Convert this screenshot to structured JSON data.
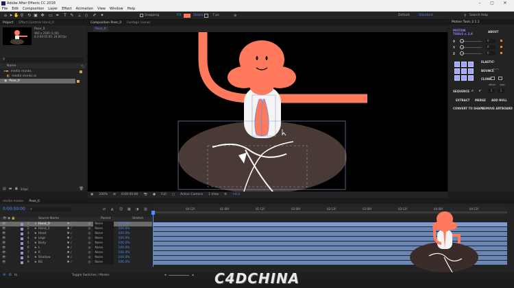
{
  "window": {
    "title": "Adobe After Effects CC 2018"
  },
  "menu": [
    "File",
    "Edit",
    "Composition",
    "Layer",
    "Effect",
    "Animation",
    "View",
    "Window",
    "Help"
  ],
  "toolbar": {
    "snapping_label": "Snapping",
    "fill_label": "Fill:",
    "stroke_label": "Stroke:",
    "stroke_px": "7 px",
    "workspace_default": "Default",
    "workspace_standard": "Standard",
    "search_placeholder": "Search Help"
  },
  "project_panel": {
    "tab_project": "Project",
    "tab_effect_controls": "Effect Controls Hand_0",
    "comp_name": "Pose_0",
    "comp_info_1": "960 x 2500 (1.00)",
    "comp_info_2": "Δ 0:00:05:00, 24.00 fps",
    "name_header": "Name",
    "items": [
      "media monks",
      "media monks.ai",
      "Pose_0"
    ]
  },
  "composition_panel": {
    "tab_composition": "Composition Pose_0",
    "tab_footage": "Footage (none)",
    "breadcrumb": "Pose_0",
    "zoom": "200%",
    "timecode": "0:00:00:00",
    "resolution": "Full",
    "camera": "Active Camera",
    "views": "1 View",
    "offset": "+0.0"
  },
  "motion_tools": {
    "title": "Motion Tools 2.1.1",
    "brand_line1": "MOTION",
    "brand_line2": "TOOLS v. 2.0",
    "about": "ABOUT",
    "x_label": "X",
    "y_label": "Y",
    "z_label": "Z",
    "x_value": "0",
    "y_value": "0",
    "z_value": "0",
    "elastic": "ELASTIC",
    "bounce": "BOUNCE",
    "clone": "CLONE",
    "offset": "offset",
    "step": "step",
    "sequence": "SEQUENCE",
    "seq_value": "1",
    "extract": "EXTRACT",
    "merge": "MERGE",
    "add_null": "ADD NULL",
    "convert_shape": "CONVERT TO SHAPE",
    "remove_artboard": "REMOVE ARTBOARD"
  },
  "timeline": {
    "tab_media": "media monks",
    "tab_pose": "Pose_0",
    "timecode": "0:00:00:00",
    "source_name_header": "Source Name",
    "parent_header": "Parent",
    "stretch_header": "Stretch",
    "toggle_label": "Toggle Switches / Modes",
    "ruler": [
      "00:12f",
      "01:00f",
      "01:12f",
      "02:00f",
      "02:12f",
      "03:00f",
      "03:12f",
      "04:00f",
      "04:12f"
    ],
    "layers": [
      {
        "num": "1",
        "name": "Hand_0",
        "parent": "None",
        "stretch": "100.0%"
      },
      {
        "num": "2",
        "name": "Hand_1",
        "parent": "None",
        "stretch": "100.0%"
      },
      {
        "num": "3",
        "name": "Head",
        "parent": "None",
        "stretch": "100.0%"
      },
      {
        "num": "4",
        "name": "Legs",
        "parent": "None",
        "stretch": "100.0%"
      },
      {
        "num": "5",
        "name": "Body",
        "parent": "None",
        "stretch": "100.0%"
      },
      {
        "num": "6",
        "name": "L",
        "parent": "None",
        "stretch": "100.0%"
      },
      {
        "num": "7",
        "name": "R",
        "parent": "None",
        "stretch": "100.0%"
      },
      {
        "num": "8",
        "name": "Shadow",
        "parent": "None",
        "stretch": "100.0%"
      },
      {
        "num": "9",
        "name": "BG",
        "parent": "None",
        "stretch": "100.0%"
      }
    ]
  },
  "watermark": "C4DCHINA",
  "colors": {
    "character_orange": "#ff7a5c",
    "legs_dark": "#4a3a35",
    "track_blue": "#6a86b6",
    "accent_blue": "#4e8dff"
  }
}
